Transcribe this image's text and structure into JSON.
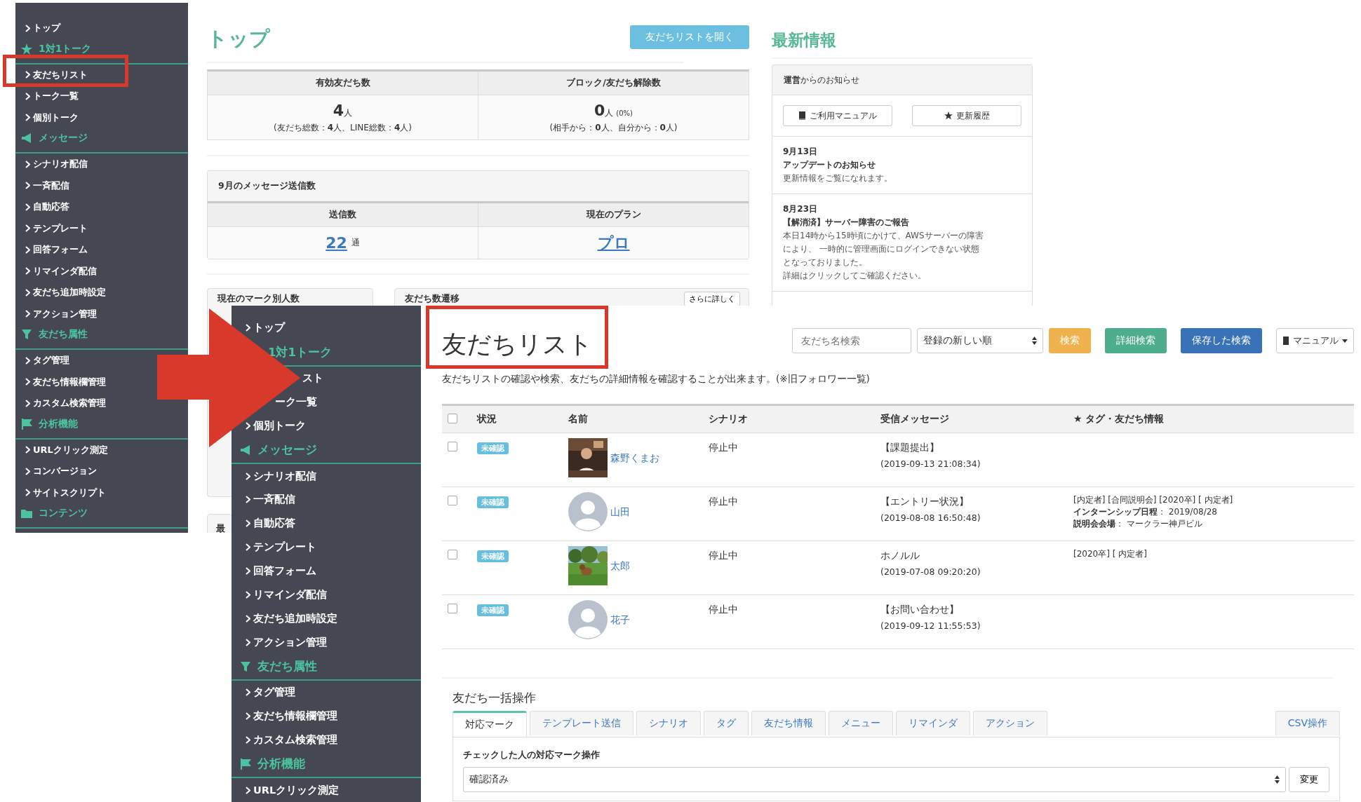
{
  "annotations": [
    {
      "kind": "frame"
    },
    {
      "kind": "arrow"
    },
    {
      "kind": "frame"
    }
  ],
  "top_screen": {
    "sidebar": [
      {
        "kind": "item",
        "label": "トップ"
      },
      {
        "kind": "section",
        "label": "1対1トーク"
      },
      {
        "kind": "item",
        "label": "友だちリスト"
      },
      {
        "kind": "item",
        "label": "トーク一覧"
      },
      {
        "kind": "item",
        "label": "個別トーク"
      },
      {
        "kind": "section",
        "label": "メッセージ"
      },
      {
        "kind": "item",
        "label": "シナリオ配信"
      },
      {
        "kind": "item",
        "label": "一斉配信"
      },
      {
        "kind": "item",
        "label": "自動応答"
      },
      {
        "kind": "item",
        "label": "テンプレート"
      },
      {
        "kind": "item",
        "label": "回答フォーム"
      },
      {
        "kind": "item",
        "label": "リマインダ配信"
      },
      {
        "kind": "item",
        "label": "友だち追加時設定"
      },
      {
        "kind": "item",
        "label": "アクション管理"
      },
      {
        "kind": "section",
        "label": "友だち属性"
      },
      {
        "kind": "item",
        "label": "タグ管理"
      },
      {
        "kind": "item",
        "label": "友だち情報欄管理"
      },
      {
        "kind": "item",
        "label": "カスタム検索管理"
      },
      {
        "kind": "section",
        "label": "分析機能"
      },
      {
        "kind": "item",
        "label": "URLクリック測定"
      },
      {
        "kind": "item",
        "label": "コンバージョン"
      },
      {
        "kind": "item",
        "label": "サイトスクリプト"
      },
      {
        "kind": "section",
        "label": "コンテンツ"
      }
    ],
    "title": "トップ",
    "open_button": "友だちリストを開く",
    "stats": [
      {
        "heading": "有効友だち数",
        "value": "4",
        "unit": "人",
        "note": "(友だち総数：**4**人、LINE総数：**4**人)"
      },
      {
        "heading": "ブロック/友だち解除数",
        "value": "0",
        "unit": "人",
        "extra": "(0%)",
        "note": "(相手から：**0**人、自分から：**0**人)"
      }
    ],
    "messages": {
      "title": "9月のメッセージ送信数",
      "columns": [
        {
          "heading": "送信数",
          "value": "22",
          "unit": "通"
        },
        {
          "heading": "現在のプラン",
          "value": "プロ"
        }
      ]
    },
    "cards": [
      {
        "title": "現在のマーク別人数"
      },
      {
        "title": "友だち数遷移",
        "button": "さらに詳しく"
      },
      {
        "title": "最"
      }
    ],
    "news": {
      "title": "最新情報",
      "panel_title": "**運営**からのお知らせ",
      "buttons": [
        "ご利用マニュアル",
        "更新履歴"
      ],
      "items": [
        {
          "date": "9月13日",
          "headline": "アップデートのお知らせ",
          "body": [
            "更新情報をご覧になれます。"
          ]
        },
        {
          "date": "8月23日",
          "headline": "【解消済】サーバー障害のご報告",
          "body": [
            "本日14時から15時頃にかけて、AWSサーバーの障害",
            "により、 一時的に管理画面にログインできない状態",
            "となっておりました。",
            "詳細はクリックしてご確認ください。"
          ]
        }
      ]
    }
  },
  "list_screen": {
    "sidebar": [
      {
        "kind": "item",
        "label": "トップ"
      },
      {
        "kind": "section-cut",
        "label": "1対1トーク"
      },
      {
        "kind": "cut",
        "label": "スト"
      },
      {
        "kind": "cut",
        "label": "ーク一覧"
      },
      {
        "kind": "item",
        "label": "個別トーク"
      },
      {
        "kind": "section",
        "label": "メッセージ"
      },
      {
        "kind": "item",
        "label": "シナリオ配信"
      },
      {
        "kind": "item",
        "label": "一斉配信"
      },
      {
        "kind": "item",
        "label": "自動応答"
      },
      {
        "kind": "item",
        "label": "テンプレート"
      },
      {
        "kind": "item",
        "label": "回答フォーム"
      },
      {
        "kind": "item",
        "label": "リマインダ配信"
      },
      {
        "kind": "item",
        "label": "友だち追加時設定"
      },
      {
        "kind": "item",
        "label": "アクション管理"
      },
      {
        "kind": "section",
        "label": "友だち属性"
      },
      {
        "kind": "item",
        "label": "タグ管理"
      },
      {
        "kind": "item",
        "label": "友だち情報欄管理"
      },
      {
        "kind": "item",
        "label": "カスタム検索管理"
      },
      {
        "kind": "section",
        "label": "分析機能"
      },
      {
        "kind": "item",
        "label": "URLクリック測定"
      }
    ],
    "title": "友だちリスト",
    "description": "友だちリストの確認や検索、友だちの詳細情報を確認することが出来ます。(※旧フォロワー一覧)",
    "search": {
      "placeholder": "友だち名検索"
    },
    "sort": "登録の新しい順",
    "buttons": [
      {
        "kind": "warning",
        "label": "検索"
      },
      {
        "kind": "success",
        "label": "詳細検索"
      },
      {
        "kind": "primary",
        "label": "保存した検索"
      },
      {
        "kind": "dropdown",
        "label": "マニュアル"
      }
    ],
    "table": {
      "header_checked": false,
      "columns": [
        "状況",
        "名前",
        "シナリオ",
        "受信メッセージ",
        "★ タグ・友だち情報"
      ],
      "rows": [
        {
          "checked": false,
          "status": "未確認",
          "avatar": {
            "kind": "picture"
          },
          "name": "森野くまお",
          "scenario": "停止中",
          "message": "【課題提出】",
          "time": "(2019-09-13 21:08:34)",
          "tags": []
        },
        {
          "checked": false,
          "status": "未確認",
          "avatar": {
            "kind": "default"
          },
          "name": "山田",
          "scenario": "停止中",
          "message": "【エントリー状況】",
          "time": "(2019-08-08 16:50:48)",
          "tags": [
            "[内定者] [合同説明会] [2020卒] [ 内定者]",
            "**インターンシップ日程**： 2019/08/28",
            "**説明会会場**： マークラー神戸ビル"
          ]
        },
        {
          "checked": false,
          "status": "未確認",
          "avatar": {
            "kind": "picture"
          },
          "name": "太郎",
          "scenario": "停止中",
          "message": "ホノルル",
          "time": "(2019-07-08 09:20:20)",
          "tags": [
            "[2020卒] [ 内定者]"
          ]
        },
        {
          "checked": false,
          "status": "未確認",
          "avatar": {
            "kind": "default"
          },
          "name": "花子",
          "scenario": "停止中",
          "message": "【お問い合わせ】",
          "time": "(2019-09-12 11:55:53)",
          "tags": []
        }
      ]
    },
    "bulk": {
      "title": "友だち一括操作",
      "tabs": [
        {
          "label": "対応マーク",
          "selected": true
        },
        {
          "label": "テンプレート送信",
          "selected": false
        },
        {
          "label": "シナリオ",
          "selected": false
        },
        {
          "label": "タグ",
          "selected": false
        },
        {
          "label": "友だち情報",
          "selected": false
        },
        {
          "label": "メニュー",
          "selected": false
        },
        {
          "label": "リマインダ",
          "selected": false
        },
        {
          "label": "アクション",
          "selected": false
        }
      ],
      "side_tab": {
        "label": "CSV操作",
        "selected": false
      },
      "label": "チェックした人の対応マーク操作",
      "select": "確認済み",
      "button": "変更"
    }
  }
}
